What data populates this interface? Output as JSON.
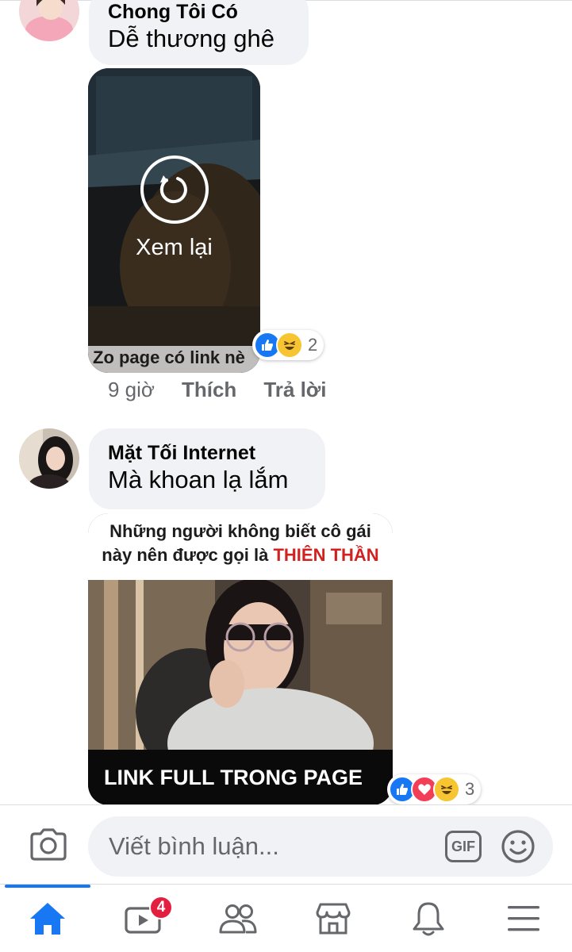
{
  "comments": [
    {
      "author": "Chong Tôi Có",
      "text": "Dễ thương ghê",
      "media": {
        "overlay_label": "Xem lại",
        "caption": "Zo page có link nè"
      },
      "reactions": {
        "icons": [
          "like-icon",
          "haha-icon"
        ],
        "count": "2"
      },
      "time": "9 giờ",
      "like_label": "Thích",
      "reply_label": "Trả lời"
    },
    {
      "author": "Mặt Tối Internet",
      "text": "Mà khoan lạ lắm",
      "media": {
        "caption_top_line1": "Những người không biết cô gái",
        "caption_top_line2_prefix": "này nên được gọi là",
        "caption_top_line2_highlight": "THIÊN THẦN",
        "caption_bottom": "LINK FULL TRONG PAGE"
      },
      "reactions": {
        "icons": [
          "like-icon",
          "love-icon",
          "haha-icon"
        ],
        "count": "3"
      }
    }
  ],
  "composer": {
    "placeholder": "Viết bình luận...",
    "gif_label": "GIF"
  },
  "tabbar": {
    "items": [
      "home-icon",
      "video-icon",
      "friends-icon",
      "marketplace-icon",
      "notifications-icon",
      "menu-icon"
    ],
    "video_badge": "4"
  },
  "colors": {
    "accent": "#1877f2",
    "bubble": "#f0f2f5",
    "secondary_text": "#65676b",
    "badge": "#e41e3f",
    "highlight_red": "#d32020"
  }
}
